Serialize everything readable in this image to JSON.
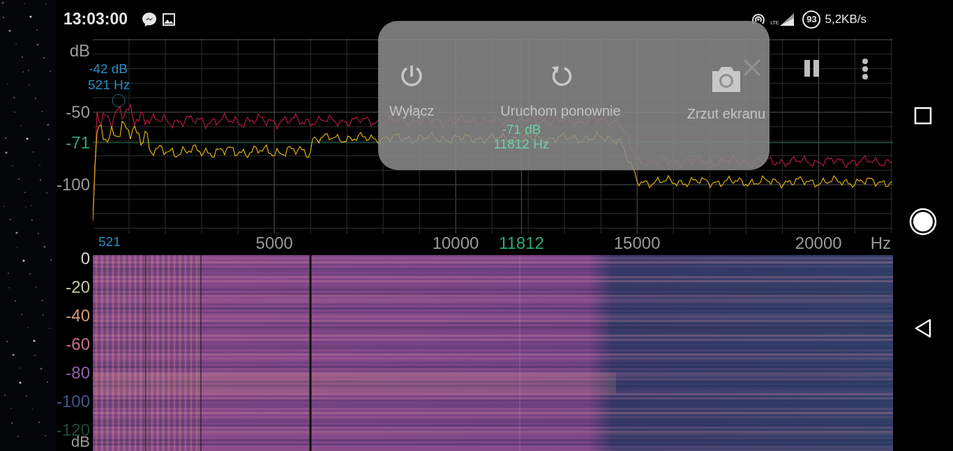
{
  "status_bar": {
    "time": "13:03:00",
    "network_type": "LTE",
    "battery": "93",
    "network_speed": "5,2KB/s"
  },
  "spectrum": {
    "y_unit": "dB",
    "y_ticks": [
      "-50",
      "-100"
    ],
    "x_ticks": [
      "5000",
      "10000",
      "15000",
      "20000"
    ],
    "x_unit": "Hz",
    "peak_marker": {
      "level_label": "-42 dB",
      "freq_label": "521 Hz",
      "x_label": "521"
    },
    "cursor": {
      "level_label": "-71 dB",
      "freq_label": "11812 Hz",
      "x_label": "11812",
      "y_label": "-71"
    }
  },
  "power_menu": {
    "items": [
      {
        "kind": "power",
        "label": "Wyłącz"
      },
      {
        "kind": "restart",
        "label": "Uruchom ponownie"
      },
      {
        "kind": "screenshot",
        "label": "Zrzut ekranu"
      }
    ]
  },
  "spectrogram": {
    "scale": [
      {
        "label": "0",
        "color": "#d8d8d8"
      },
      {
        "label": "-20",
        "color": "#c8c89a"
      },
      {
        "label": "-40",
        "color": "#d49a7c"
      },
      {
        "label": "-60",
        "color": "#c86e8c"
      },
      {
        "label": "-80",
        "color": "#9060a8"
      },
      {
        "label": "-100",
        "color": "#3c5888"
      },
      {
        "label": "-120",
        "color": "#1e4a3c"
      }
    ],
    "unit": "dB"
  }
}
